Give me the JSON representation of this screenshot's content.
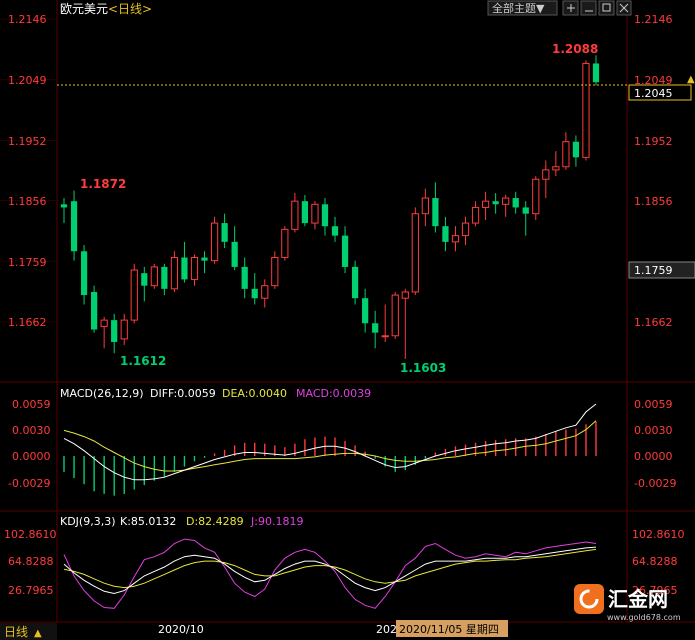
{
  "header": {
    "symbol": "欧元美元",
    "period": "<日线>",
    "theme_button": "全部主题▼",
    "colors": {
      "up": "#ff3b3b",
      "down": "#00d070",
      "axis": "#ff3b3b",
      "white": "#ffffff",
      "yellow": "#e6e63a",
      "magenta": "#e040e0",
      "grid": "#5a0000"
    }
  },
  "main_axis": {
    "ticks": [
      "1.2146",
      "1.2049",
      "1.1952",
      "1.1856",
      "1.1759",
      "1.1662"
    ],
    "current_price": "1.2045",
    "crosshair_price": "1.1759",
    "annotations": {
      "high": "1.2088",
      "mid_high": "1.1872",
      "low_left": "1.1612",
      "low_right": "1.1603"
    }
  },
  "macd": {
    "label": "MACD(26,12,9)",
    "diff": "DIFF:0.0059",
    "dea": "DEA:0.0040",
    "macd": "MACD:0.0039",
    "ticks": [
      "0.0059",
      "0.0030",
      "0.0000",
      "-0.0029"
    ]
  },
  "kdj": {
    "label": "KDJ(9,3,3)",
    "k": "K:85.0132",
    "d": "D:82.4289",
    "j": "J:90.1819",
    "ticks": [
      "102.8610",
      "64.8288",
      "26.7965"
    ]
  },
  "footer": {
    "period_button": "日线",
    "date_label": "2020/10",
    "date_label2": "2020",
    "cursor_date": "2020/11/05 星期四"
  },
  "watermark": {
    "brand": "汇金网",
    "url": "www.gold678.com"
  },
  "chart_data": {
    "type": "candlestick",
    "title": "欧元美元 <日线>",
    "ylim": [
      1.1565,
      1.2146
    ],
    "candles": [
      {
        "o": 1.185,
        "h": 1.186,
        "l": 1.182,
        "c": 1.1845
      },
      {
        "o": 1.1855,
        "h": 1.1872,
        "l": 1.176,
        "c": 1.1775
      },
      {
        "o": 1.1775,
        "h": 1.1785,
        "l": 1.169,
        "c": 1.1705
      },
      {
        "o": 1.171,
        "h": 1.172,
        "l": 1.1645,
        "c": 1.165
      },
      {
        "o": 1.1655,
        "h": 1.167,
        "l": 1.162,
        "c": 1.1665
      },
      {
        "o": 1.1665,
        "h": 1.1675,
        "l": 1.1612,
        "c": 1.163
      },
      {
        "o": 1.1635,
        "h": 1.1675,
        "l": 1.1625,
        "c": 1.1665
      },
      {
        "o": 1.1665,
        "h": 1.1755,
        "l": 1.166,
        "c": 1.1745
      },
      {
        "o": 1.174,
        "h": 1.175,
        "l": 1.1695,
        "c": 1.172
      },
      {
        "o": 1.172,
        "h": 1.1755,
        "l": 1.1715,
        "c": 1.175
      },
      {
        "o": 1.175,
        "h": 1.1755,
        "l": 1.1705,
        "c": 1.1715
      },
      {
        "o": 1.1715,
        "h": 1.1775,
        "l": 1.171,
        "c": 1.1765
      },
      {
        "o": 1.1765,
        "h": 1.179,
        "l": 1.1725,
        "c": 1.173
      },
      {
        "o": 1.173,
        "h": 1.177,
        "l": 1.172,
        "c": 1.1765
      },
      {
        "o": 1.1765,
        "h": 1.1775,
        "l": 1.174,
        "c": 1.176
      },
      {
        "o": 1.176,
        "h": 1.183,
        "l": 1.1755,
        "c": 1.182
      },
      {
        "o": 1.182,
        "h": 1.1835,
        "l": 1.178,
        "c": 1.179
      },
      {
        "o": 1.179,
        "h": 1.1815,
        "l": 1.1745,
        "c": 1.175
      },
      {
        "o": 1.175,
        "h": 1.1765,
        "l": 1.17,
        "c": 1.1715
      },
      {
        "o": 1.1715,
        "h": 1.174,
        "l": 1.169,
        "c": 1.17
      },
      {
        "o": 1.17,
        "h": 1.173,
        "l": 1.1685,
        "c": 1.172
      },
      {
        "o": 1.172,
        "h": 1.1775,
        "l": 1.1715,
        "c": 1.1765
      },
      {
        "o": 1.1765,
        "h": 1.1815,
        "l": 1.176,
        "c": 1.181
      },
      {
        "o": 1.181,
        "h": 1.1868,
        "l": 1.1805,
        "c": 1.1855
      },
      {
        "o": 1.1855,
        "h": 1.1865,
        "l": 1.1815,
        "c": 1.182
      },
      {
        "o": 1.182,
        "h": 1.1855,
        "l": 1.181,
        "c": 1.185
      },
      {
        "o": 1.185,
        "h": 1.186,
        "l": 1.18,
        "c": 1.1815
      },
      {
        "o": 1.1815,
        "h": 1.183,
        "l": 1.179,
        "c": 1.18
      },
      {
        "o": 1.18,
        "h": 1.1815,
        "l": 1.174,
        "c": 1.175
      },
      {
        "o": 1.175,
        "h": 1.176,
        "l": 1.169,
        "c": 1.17
      },
      {
        "o": 1.17,
        "h": 1.1715,
        "l": 1.1645,
        "c": 1.166
      },
      {
        "o": 1.166,
        "h": 1.168,
        "l": 1.162,
        "c": 1.1645
      },
      {
        "o": 1.164,
        "h": 1.169,
        "l": 1.163,
        "c": 1.164
      },
      {
        "o": 1.164,
        "h": 1.171,
        "l": 1.1635,
        "c": 1.1705
      },
      {
        "o": 1.17,
        "h": 1.1715,
        "l": 1.1603,
        "c": 1.171
      },
      {
        "o": 1.171,
        "h": 1.1845,
        "l": 1.1705,
        "c": 1.1835
      },
      {
        "o": 1.1835,
        "h": 1.1875,
        "l": 1.1815,
        "c": 1.186
      },
      {
        "o": 1.186,
        "h": 1.1885,
        "l": 1.1805,
        "c": 1.1815
      },
      {
        "o": 1.1815,
        "h": 1.183,
        "l": 1.1775,
        "c": 1.179
      },
      {
        "o": 1.179,
        "h": 1.1815,
        "l": 1.1775,
        "c": 1.18
      },
      {
        "o": 1.18,
        "h": 1.183,
        "l": 1.1785,
        "c": 1.182
      },
      {
        "o": 1.182,
        "h": 1.1855,
        "l": 1.1815,
        "c": 1.1845
      },
      {
        "o": 1.1845,
        "h": 1.187,
        "l": 1.1825,
        "c": 1.1855
      },
      {
        "o": 1.1855,
        "h": 1.1868,
        "l": 1.1835,
        "c": 1.185
      },
      {
        "o": 1.185,
        "h": 1.1865,
        "l": 1.183,
        "c": 1.186
      },
      {
        "o": 1.186,
        "h": 1.187,
        "l": 1.1835,
        "c": 1.1845
      },
      {
        "o": 1.1845,
        "h": 1.1855,
        "l": 1.18,
        "c": 1.1835
      },
      {
        "o": 1.1835,
        "h": 1.1895,
        "l": 1.1825,
        "c": 1.189
      },
      {
        "o": 1.189,
        "h": 1.192,
        "l": 1.186,
        "c": 1.1905
      },
      {
        "o": 1.1905,
        "h": 1.1935,
        "l": 1.1895,
        "c": 1.191
      },
      {
        "o": 1.191,
        "h": 1.1965,
        "l": 1.1905,
        "c": 1.195
      },
      {
        "o": 1.195,
        "h": 1.196,
        "l": 1.191,
        "c": 1.1925
      },
      {
        "o": 1.1925,
        "h": 1.208,
        "l": 1.192,
        "c": 1.2075
      },
      {
        "o": 1.2075,
        "h": 1.2088,
        "l": 1.204,
        "c": 1.2045
      }
    ],
    "macd_hist": [
      -0.0018,
      -0.0025,
      -0.0032,
      -0.004,
      -0.0043,
      -0.0045,
      -0.0043,
      -0.0038,
      -0.0033,
      -0.0028,
      -0.0024,
      -0.0018,
      -0.0012,
      -0.0006,
      -0.0002,
      0.0003,
      0.0007,
      0.0012,
      0.0015,
      0.0015,
      0.0014,
      0.0012,
      0.001,
      0.0014,
      0.0019,
      0.0021,
      0.0022,
      0.0021,
      0.0017,
      0.0012,
      0.0005,
      -0.0003,
      -0.0012,
      -0.0018,
      -0.0016,
      -0.001,
      -0.0003,
      0.0004,
      0.0008,
      0.0011,
      0.0013,
      0.0015,
      0.0017,
      0.0018,
      0.0019,
      0.002,
      0.002,
      0.0022,
      0.0025,
      0.0028,
      0.003,
      0.0031,
      0.0036,
      0.0039
    ],
    "macd_diff": [
      0.002,
      0.0014,
      0.0006,
      -0.0003,
      -0.0012,
      -0.0019,
      -0.0024,
      -0.0027,
      -0.0027,
      -0.0026,
      -0.0024,
      -0.002,
      -0.0016,
      -0.0012,
      -0.0008,
      -0.0004,
      -0.0001,
      0.0002,
      0.0004,
      0.0004,
      0.0003,
      0.0002,
      0.0001,
      0.0003,
      0.0006,
      0.0009,
      0.0011,
      0.0011,
      0.0009,
      0.0005,
      0.0,
      -0.0005,
      -0.001,
      -0.0013,
      -0.0012,
      -0.0008,
      -0.0004,
      0.0,
      0.0003,
      0.0006,
      0.0008,
      0.001,
      0.0012,
      0.0014,
      0.0015,
      0.0017,
      0.0018,
      0.002,
      0.0024,
      0.0028,
      0.0032,
      0.0035,
      0.005,
      0.0059
    ],
    "macd_dea": [
      0.0029,
      0.0026,
      0.0022,
      0.0017,
      0.001,
      0.0004,
      -0.0002,
      -0.0008,
      -0.0012,
      -0.0015,
      -0.0017,
      -0.0017,
      -0.0016,
      -0.0014,
      -0.0012,
      -0.001,
      -0.0008,
      -0.0006,
      -0.0004,
      -0.0003,
      -0.0003,
      -0.0003,
      -0.0003,
      -0.0003,
      -0.0002,
      -0.0001,
      0.0001,
      0.0002,
      0.0003,
      0.0003,
      0.0002,
      0.0,
      -0.0003,
      -0.0005,
      -0.0006,
      -0.0006,
      -0.0005,
      -0.0004,
      -0.0002,
      -0.0001,
      0.0001,
      0.0003,
      0.0004,
      0.0006,
      0.0007,
      0.0009,
      0.0011,
      0.0012,
      0.0014,
      0.0017,
      0.002,
      0.0023,
      0.003,
      0.004
    ],
    "kdj_k": [
      62,
      50,
      40,
      32,
      25,
      22,
      26,
      36,
      46,
      52,
      58,
      66,
      72,
      74,
      72,
      70,
      62,
      52,
      44,
      38,
      40,
      48,
      56,
      62,
      66,
      66,
      62,
      56,
      46,
      36,
      30,
      26,
      30,
      38,
      46,
      54,
      62,
      66,
      66,
      66,
      66,
      68,
      70,
      70,
      70,
      72,
      72,
      74,
      76,
      78,
      80,
      82,
      84,
      85
    ],
    "kdj_d": [
      55,
      52,
      48,
      42,
      36,
      32,
      30,
      32,
      36,
      42,
      48,
      54,
      60,
      64,
      66,
      66,
      64,
      60,
      54,
      48,
      46,
      46,
      50,
      54,
      58,
      60,
      60,
      58,
      54,
      48,
      42,
      38,
      36,
      38,
      40,
      46,
      50,
      54,
      58,
      62,
      64,
      66,
      66,
      67,
      68,
      68,
      70,
      71,
      72,
      74,
      76,
      78,
      80,
      82
    ],
    "kdj_j": [
      75,
      46,
      26,
      12,
      3,
      2,
      20,
      45,
      68,
      72,
      78,
      90,
      96,
      94,
      84,
      78,
      58,
      36,
      24,
      18,
      28,
      54,
      70,
      78,
      82,
      78,
      66,
      52,
      30,
      14,
      6,
      2,
      18,
      38,
      60,
      70,
      86,
      90,
      82,
      74,
      70,
      72,
      76,
      74,
      72,
      78,
      76,
      80,
      84,
      86,
      88,
      90,
      92,
      90
    ]
  }
}
